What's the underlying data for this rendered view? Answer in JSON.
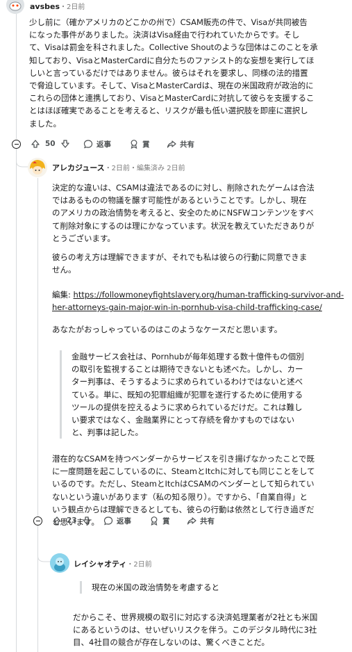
{
  "comments": [
    {
      "username": "avsbes",
      "time": "・2日前",
      "body": "少し前に（確かアメリカのどこかの州で）CSAM販売の件で、Visaが共同被告\nになった事件がありました。決済はVisa経由で行われていたからです。そし\nて、Visaは罰金を科されました。Collective Shoutのような団体はこのことを承\n知しており、VisaとMasterCardに自分たちのファシスト的な妄想を実行してほ\nしいと言っているだけではありません。彼らはそれを要求し、同様の法的措置\nで脅迫しています。そして、VisaとMasterCardは、現在の米国政府が政治的に\nこれらの団体と連携しており、VisaとMasterCardに対抗して彼らを支援するこ\nとはほぼ確実であることを考えると、リスクが最も低い選択肢を即座に選択し\nました。",
      "votes": "50",
      "reply": "返事",
      "award": "賞",
      "share": "共有"
    },
    {
      "username": "アレカジュース",
      "time": "・2日前・編集済み 2日前",
      "body_p1": "決定的な違いは、CSAMは違法であるのに対し、削除されたゲームは合法\nではあるものの物議を醸す可能性があるということです。しかし、現在\nのアメリカの政治情勢を考えると、安全のためにNSFWコンテンツをすべ\nて削除対象にするのは理にかなっています。状況を教えていただきありが\nとうございます。",
      "body_p2": "彼らの考え方は理解できますが、それでも私は彼らの行動に同意できま\nせん。",
      "edit_label": "編集: ",
      "edit_link": "https://followmoneyfightslavery.org/human-trafficking-survivor-and-\nher-attorneys-gain-major-win-in-pornhub-visa-child-trafficking-case/",
      "body_p3": "あなたがおっしゃっているのはこのようなケースだと思います。",
      "quote": "金融サービス会社は、Pornhubが毎年処理する数十億件もの個別\nの取引を監視することは期待できないとも述べた。しかし、カー\nター判事は、そうするように求められているわけではないと述べ\nている。単に、既知の犯罪組織が犯罪を遂行するために使用する\nツールの提供を控えるように求められているだけだ。これは難し\nい要求ではなく、金融業界にとって存続を脅かすものではない\nと、判事は記した。",
      "body_p4": "潜在的なCSAMを持つベンダーからサービスを引き揚げなかったことで既\nに一度問題を起こしているのに、SteamとItchに対しても同じことをして\nいるのです。ただし、SteamとItchはCSAMのベンダーとして知られてい\nないという違いがあります（私の知る限り）。ですから、「自業自得」と\nいう観点からは理解できるとしても、彼らの行動は依然として行き過ぎだ\nと思います。",
      "votes": "23",
      "reply": "返事",
      "award": "賞",
      "share": "共有"
    },
    {
      "username": "レイシャオティ",
      "time": "・2日前",
      "quote": "現在の米国の政治情勢を考慮すると",
      "body": "だからこそ、世界規模の取引に対応する決済処理業者が2社とも米国\nにあるというのは、せいぜいリスクを伴う。このデジタル時代に3社\n目、4社目の競合が存在しないのは、驚くべきことだ。"
    }
  ]
}
